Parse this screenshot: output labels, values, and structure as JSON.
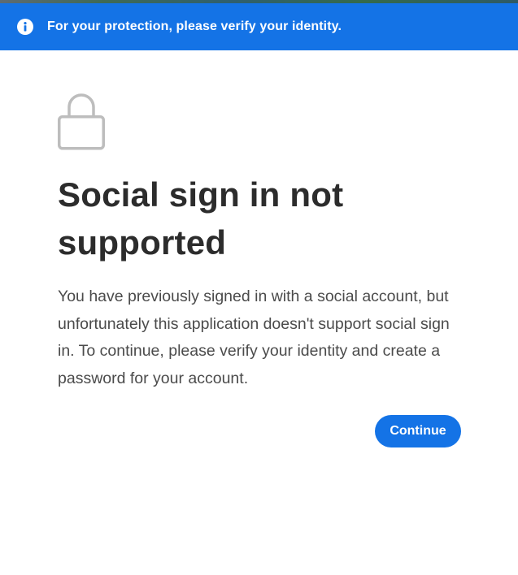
{
  "banner": {
    "icon": "info-icon",
    "text": "For your protection, please verify your identity."
  },
  "main": {
    "icon": "lock-icon",
    "title": "Social sign in not supported",
    "body": "You have previously signed in with a social account, but unfortunately this application doesn't support social sign in. To continue, please verify your identity and create a password for your account."
  },
  "actions": {
    "continue_label": "Continue"
  },
  "colors": {
    "accent": "#1473e6",
    "title": "#2c2c2c",
    "body_text": "#4b4b4b",
    "icon_gray": "#bdbdbd"
  }
}
